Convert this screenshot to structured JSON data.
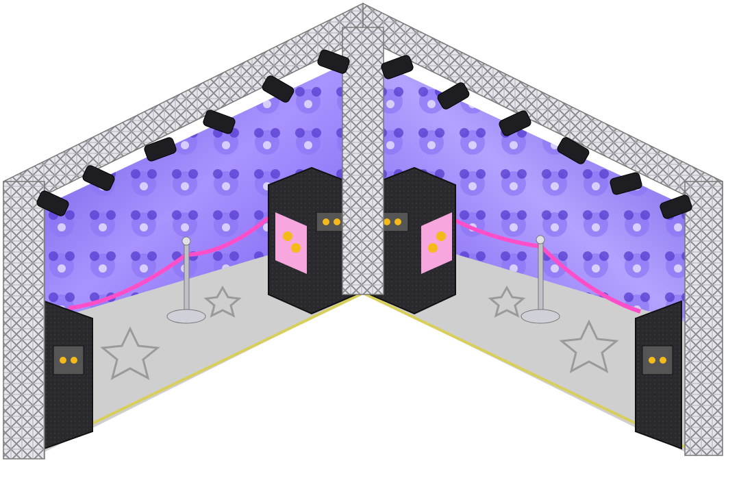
{
  "scene": {
    "type": "isometric-room",
    "colors": {
      "background": "#ffffff",
      "truss": "#d8d8dc",
      "truss_dark": "#8a8a94",
      "wall_light": "#b9a6ff",
      "wall_dark": "#5a3fd0",
      "floor": "#cfcfcf",
      "floor_edge": "#d8cf5a",
      "speaker": "#2a2a2e",
      "rope": "#ff4fc8",
      "panel_pink": "#f7a6de",
      "star": "#f5b91a"
    },
    "objects": [
      "truss-frame",
      "crowd-wall-left",
      "crowd-wall-right",
      "floor",
      "speaker-left",
      "speaker-center-left",
      "speaker-center-right",
      "speaker-right",
      "stanchion-left",
      "stanchion-right",
      "velvet-rope",
      "spotlights"
    ]
  }
}
